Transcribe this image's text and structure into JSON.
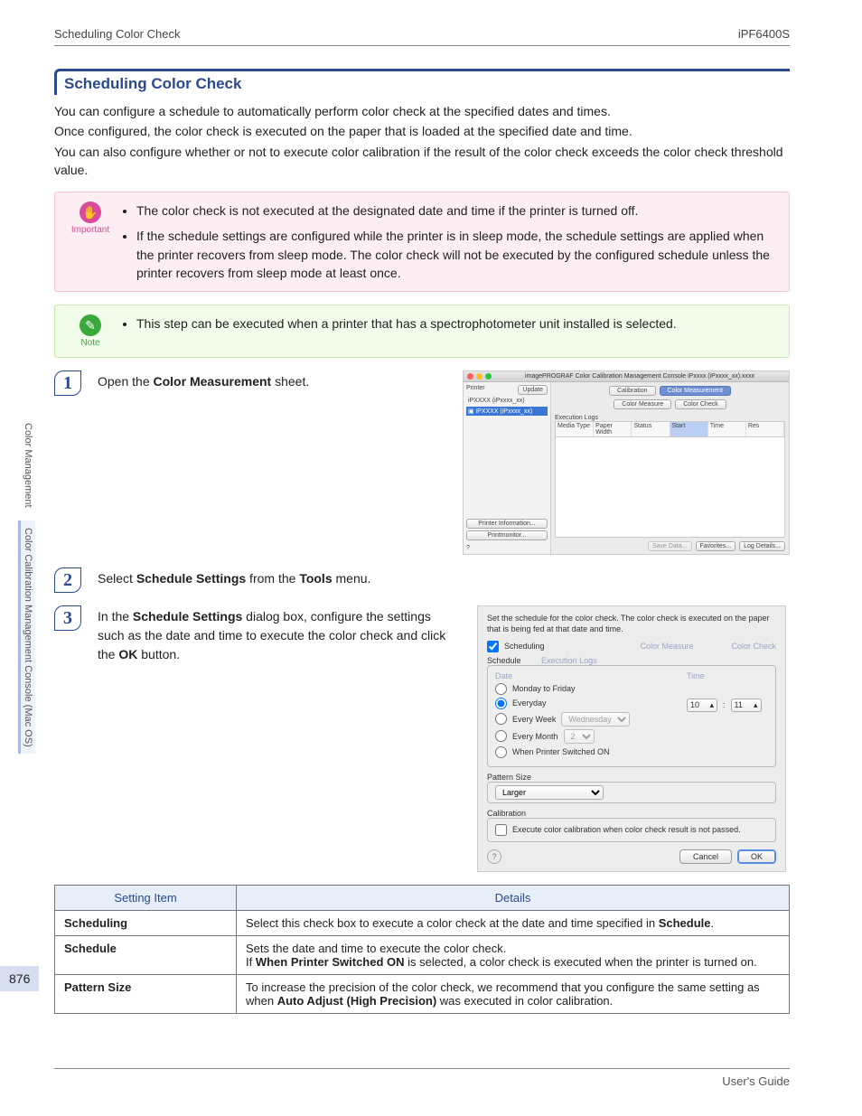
{
  "header": {
    "left": "Scheduling Color Check",
    "right": "iPF6400S"
  },
  "sideTabs": {
    "a": "Color Management",
    "b": "Color Calibration Management Console (Mac OS)"
  },
  "title": "Scheduling Color Check",
  "intro": {
    "p1": "You can configure a schedule to automatically perform color check at the specified dates and times.",
    "p2": "Once configured, the color check is executed on the paper that is loaded at the specified date and time.",
    "p3": "You can also configure whether or not to execute color calibration if the result of the color check exceeds the color check threshold value."
  },
  "important": {
    "label": "Important",
    "li1": "The color check is not executed at the designated date and time if the printer is turned off.",
    "li2": "If the schedule settings are configured while the printer is in sleep mode, the schedule settings are applied when the printer recovers from sleep mode. The color check will not be executed by the configured schedule unless the printer recovers from sleep mode at least once."
  },
  "note": {
    "label": "Note",
    "li1": "This step can be executed when a printer that has a spectrophotometer unit installed is selected."
  },
  "steps": {
    "s1": {
      "pre": "Open the ",
      "bold": "Color Measurement",
      "post": " sheet."
    },
    "s2": {
      "pre": "Select ",
      "b1": "Schedule Settings",
      "mid": " from the ",
      "b2": "Tools",
      "post": " menu."
    },
    "s3": {
      "pre": "In the ",
      "b1": "Schedule Settings",
      "mid": " dialog box, configure the settings such as the date and time to execute the color check and click the ",
      "b2": "OK",
      "post": " button."
    }
  },
  "shot1": {
    "title": "imagePROGRAF Color Calibration Management Console iPxxxx (iPxxxx_xx).xxxx",
    "printerLabel": "Printer",
    "updateBtn": "Update",
    "treeParent": "iPXXXX (iPxxxx_xx)",
    "treeChild": "iPXXXX (iPxxxx_xx)",
    "tabCalibration": "Calibration",
    "tabColorMeas": "Color Measurement",
    "subColorMeasure": "Color Measure",
    "subColorCheck": "Color Check",
    "execLogs": "Execution Logs",
    "colMedia": "Media Type",
    "colPaper": "Paper Width",
    "colStatus": "Status",
    "colStart": "Start",
    "colTime": "Time",
    "colRes": "Res",
    "btnPrinterInfo": "Printer Information...",
    "btnPrintmonitor": "Printmonitor...",
    "btnSave": "Save Data...",
    "btnFav": "Favorites...",
    "btnLog": "Log Details..."
  },
  "shot2": {
    "desc": "Set the schedule for the color check. The color check is executed on the paper that is being fed at that date and time.",
    "chkScheduling": "Scheduling",
    "linkColorMeasure": "Color Measure",
    "linkColorCheck": "Color Check",
    "scheduleLabel": "Schedule",
    "dateLabel": "Date",
    "timeLabel": "Time",
    "execLogs": "Execution Logs",
    "optMonFri": "Monday to Friday",
    "optEveryday": "Everyday",
    "optEveryWeek": "Every Week",
    "weekday": "Wednesday",
    "optEveryMonth": "Every Month",
    "monthday": "2",
    "optSwitchedOn": "When Printer Switched ON",
    "hour": "10",
    "minute": "11",
    "patternSizeLabel": "Pattern Size",
    "patternSizeVal": "Larger",
    "calibrationLabel": "Calibration",
    "calibChk": "Execute color calibration when color check result is not passed.",
    "cancel": "Cancel",
    "ok": "OK"
  },
  "table": {
    "h1": "Setting Item",
    "h2": "Details",
    "r1c1": "Scheduling",
    "r1c2a": "Select this check box to execute a color check at the date and time specified in ",
    "r1c2b": "Schedule",
    "r2c1": "Schedule",
    "r2c2a": "Sets the date and time to execute the color check.",
    "r2c2b": "If ",
    "r2c2c": "When Printer Switched ON",
    "r2c2d": " is selected, a color check is executed when the printer is turned on.",
    "r3c1": "Pattern Size",
    "r3c2a": "To increase the precision of the color check, we recommend that you configure the same setting as when ",
    "r3c2b": "Auto Adjust (High Precision)",
    "r3c2c": " was executed in color calibration."
  },
  "pageNumber": "876",
  "footer": {
    "right": "User's Guide"
  }
}
